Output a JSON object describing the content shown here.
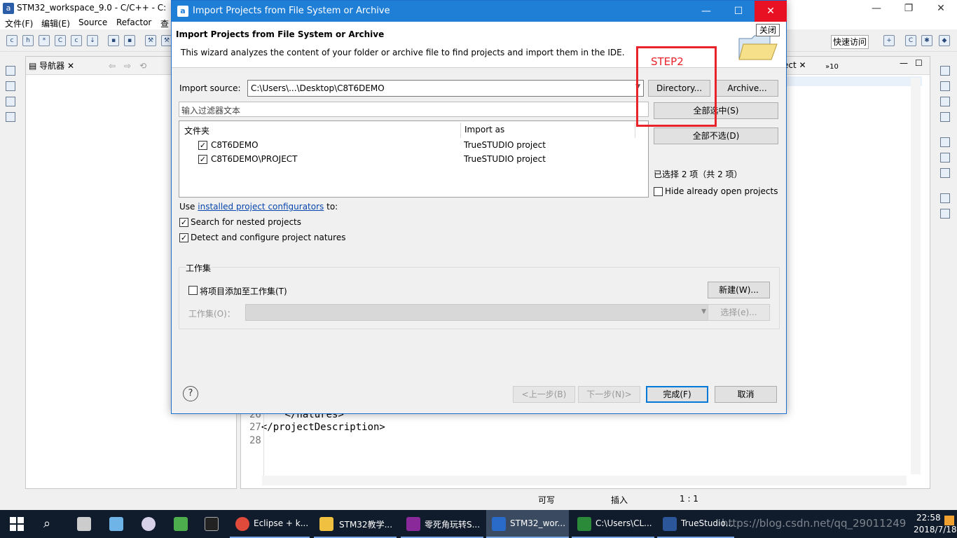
{
  "ide": {
    "title": "STM32_workspace_9.0  -  C/C++  -  C:",
    "menu": [
      "文件(F)",
      "编辑(E)",
      "Source",
      "Refactor",
      "查"
    ],
    "quick_access": "快速访问",
    "navigator_tab": "导航器",
    "editor_tab": "ect",
    "editor_overflow": "»10",
    "code_lines": [
      {
        "no": "26",
        "text": "    </natures>"
      },
      {
        "no": "27",
        "text": "</projectDescription>"
      },
      {
        "no": "28",
        "text": ""
      }
    ],
    "status": {
      "writable": "可写",
      "insert": "插入",
      "position": "1 : 1"
    }
  },
  "dialog": {
    "title": "Import Projects from File System or Archive",
    "header_title": "Import Projects from File System or Archive",
    "header_desc": "This wizard analyzes the content of your folder or archive file to find projects and import them in the IDE.",
    "close_tooltip": "关闭",
    "annotation": "STEP2",
    "import_source_label": "Import source:",
    "import_source_value": "C:\\Users\\...\\Desktop\\C8T6DEMO",
    "directory_btn": "Directory...",
    "archive_btn": "Archive...",
    "filter_placeholder": "输入过滤器文本",
    "select_all_btn": "全部选中(S)",
    "deselect_all_btn": "全部不选(D)",
    "table": {
      "headers": [
        "文件夹",
        "Import as"
      ],
      "rows": [
        {
          "folder": "C8T6DEMO",
          "import_as": "TrueSTUDIO project",
          "checked": true
        },
        {
          "folder": "C8T6DEMO\\PROJECT",
          "import_as": "TrueSTUDIO project",
          "checked": true
        }
      ]
    },
    "selected_count": "已选择 2 项（共 2 项）",
    "hide_open_label": "Hide already open projects",
    "use_prefix": "Use",
    "configurators_link": "installed project configurators",
    "use_suffix": "to:",
    "nested_label": "Search for nested projects",
    "natures_label": "Detect and configure project natures",
    "workset": {
      "group_title": "工作集",
      "add_label": "将项目添加至工作集(T)",
      "new_btn": "新建(W)...",
      "combo_label": "工作集(O)：",
      "select_btn": "选择(e)..."
    },
    "buttons": {
      "back": "<上一步(B)",
      "next": "下一步(N)>",
      "finish": "完成(F)",
      "cancel": "取消"
    }
  },
  "taskbar": {
    "items": [
      {
        "label": "Eclipse + k..."
      },
      {
        "label": "STM32教学..."
      },
      {
        "label": "零死角玩转S..."
      },
      {
        "label": "STM32_wor..."
      },
      {
        "label": "C:\\Users\\CL..."
      },
      {
        "label": "TrueStudio..."
      }
    ],
    "time": "22:58",
    "date": "2018/7/18",
    "watermark": "https://blog.csdn.net/qq_29011249"
  }
}
